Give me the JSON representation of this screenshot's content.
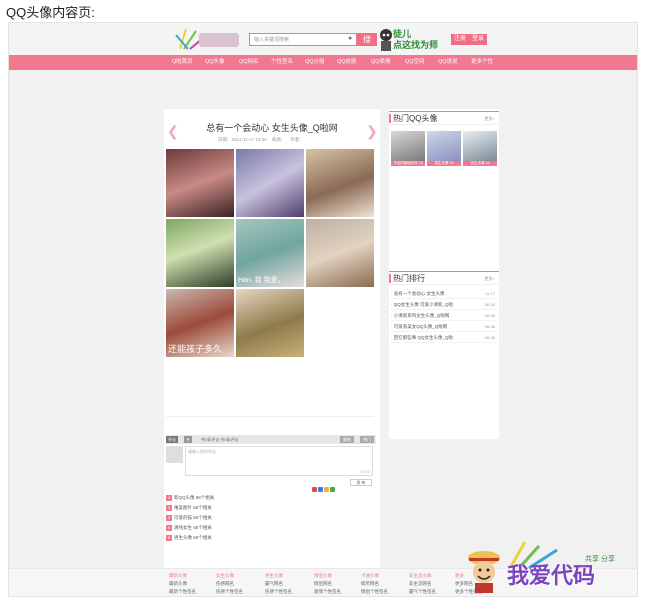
{
  "heading": "QQ头像内容页:",
  "topbar": {
    "search_placeholder": "输入关键词搜索",
    "search_button": "搜",
    "slogan_line1": "徒儿",
    "slogan_line2": "点这找为师",
    "register": "注册",
    "login": "登录"
  },
  "nav": [
    "Q啦首页",
    "QQ头像",
    "QQ网名",
    "个性签名",
    "QQ分组",
    "QQ皮肤",
    "QQ表情",
    "QQ空间",
    "QQ说说",
    "更多个性"
  ],
  "article": {
    "title": "总有一个会动心 女生头像_Q啦网",
    "meta_date": "日期：2014-11-17 15:38",
    "meta_source": "来源：",
    "meta_author": "作者：",
    "photo_caption_1": "Han, 我 我爱。",
    "photo_caption_2": "还能孩子多久"
  },
  "comments": {
    "tab_label": "评论",
    "summary": "共0条评论 共0条评论",
    "btn_latest": "最新",
    "btn_hot": "热门",
    "placeholder": "请输入您的评论",
    "count": "0/200",
    "post_button": "发 布"
  },
  "ranklist": [
    "新QQ头像 66个相关",
    "唯美图片 66个相关",
    "可爱的猫 66个相关",
    "清纯女生 66个相关",
    "男生头像 66个相关"
  ],
  "sidebar": {
    "hot_title": "热门QQ头像",
    "more": "更多>",
    "thumbs": [
      "不走的那段时光 16",
      "男生头像 18",
      "女生头像 16"
    ],
    "rank_title": "热门排行",
    "rank_items": [
      {
        "text": "· 总有一个会动心 女生头像",
        "date": "11-17"
      },
      {
        "text": "· QQ女生头像 可爱小清新_Q啦",
        "date": "08-30"
      },
      {
        "text": "· 小清新系列女生头像_Q啦网",
        "date": "08-30"
      },
      {
        "text": "· 可爱系美女QQ头像_Q啦网",
        "date": "08-30"
      },
      {
        "text": "· 回忆那些事 QQ女生头像_Q啦",
        "date": "08-30"
      }
    ]
  },
  "footer_cols": [
    {
      "title": "最新头像",
      "links": [
        "最新头像",
        "最新个性签名"
      ]
    },
    {
      "title": "女生头像",
      "links": [
        "伤感网名",
        "伤感个性签名"
      ]
    },
    {
      "title": "男生头像",
      "links": [
        "霸气网名",
        "伤感个性签名"
      ]
    },
    {
      "title": "情侣头像",
      "links": [
        "情侣网名",
        "爱情个性签名"
      ]
    },
    {
      "title": "卡通头像",
      "links": [
        "搞笑网名",
        "情侣个性签名"
      ]
    },
    {
      "title": "非主流头像",
      "links": [
        "非主流网名",
        "霸气个性签名"
      ]
    },
    {
      "title": "更多",
      "links": [
        "更多网名",
        "更多个性签名"
      ]
    }
  ],
  "brand": {
    "text": "我爱代码",
    "sub": "共享 分享"
  },
  "colors": {
    "accent": "#f27890",
    "nav": "#f27890",
    "brand": "#7b45c2"
  }
}
